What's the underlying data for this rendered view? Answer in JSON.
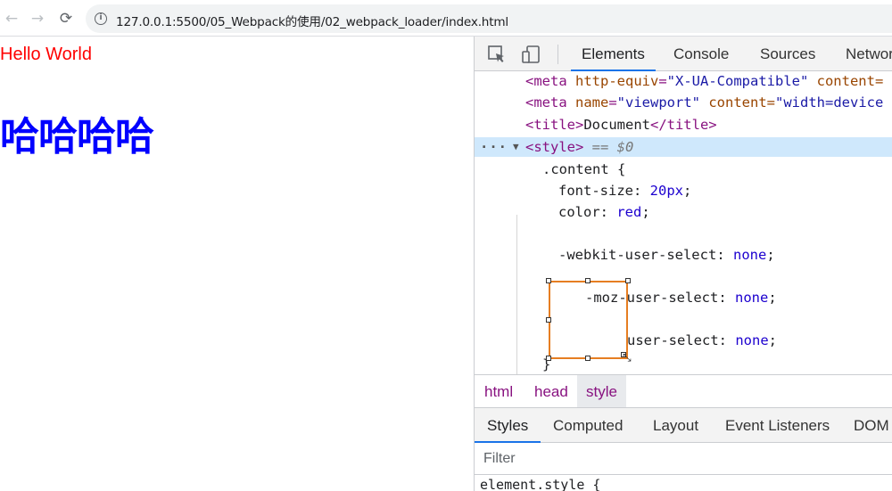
{
  "browser": {
    "back_icon": "arrow-left",
    "forward_icon": "arrow-right",
    "reload_icon": "reload",
    "info_icon": "info-circle",
    "url": "127.0.0.1:5500/05_Webpack的使用/02_webpack_loader/index.html"
  },
  "page": {
    "hello_text": "Hello World",
    "hello_color": "#ff0000",
    "haha_text": "哈哈哈哈",
    "haha_color": "#0000ff"
  },
  "devtools": {
    "toolbar": {
      "inspect_icon": "cursor-select",
      "device_icon": "device-toggle",
      "tabs": [
        "Elements",
        "Console",
        "Sources",
        "Network"
      ],
      "active_tab": "Elements"
    },
    "elements": {
      "lines": [
        {
          "tag_open": "<meta ",
          "attr1": "http-equiv",
          "val1": "\"X-UA-Compatible\"",
          "attr2": " content=",
          "rest": ""
        },
        {
          "tag_open": "<meta ",
          "attr1": "name",
          "val1": "\"viewport\"",
          "attr2": " content=",
          "val2": "\"width=device"
        },
        {
          "open": "<title>",
          "text": "Document",
          "close": "</title>"
        },
        {
          "open": "<style>",
          "marker": " == $0"
        },
        {
          "selector": ".content {"
        },
        {
          "prop": "font-size",
          "value": "20px"
        },
        {
          "prop": "color",
          "value": "red"
        },
        {
          "prop": "-webkit-user-select",
          "value": "none"
        },
        {
          "prop": "-moz-user-select",
          "value": "none"
        },
        {
          "prop": "user-select",
          "value": "none"
        },
        {
          "close": "}"
        }
      ]
    },
    "breadcrumbs": [
      "html",
      "head",
      "style"
    ],
    "active_breadcrumb": "style",
    "styles_tabs": [
      "Styles",
      "Computed",
      "Layout",
      "Event Listeners",
      "DOM"
    ],
    "active_styles_tab": "Styles",
    "filter_placeholder": "Filter",
    "element_style_text": "element.style {"
  },
  "colors": {
    "accent": "#1a73e8",
    "selection_box": "#e67e22",
    "selected_row": "#cfe8fc",
    "tag": "#881280",
    "attr": "#994500",
    "attr_value": "#1a1aa6"
  }
}
